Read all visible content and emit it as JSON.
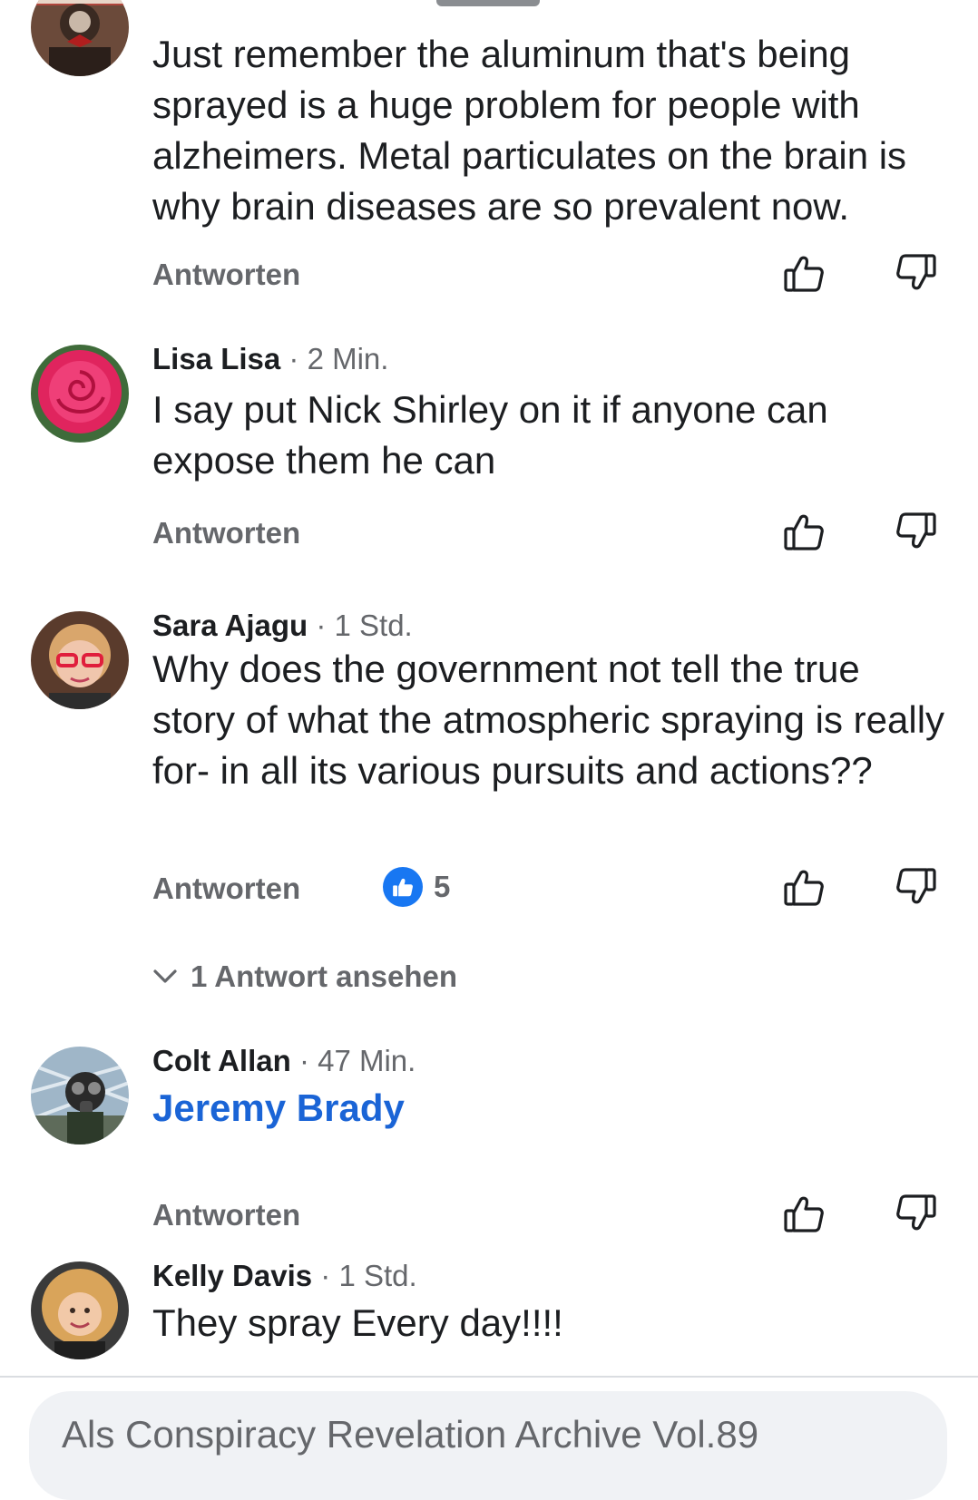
{
  "comments": [
    {
      "author": "",
      "time": "",
      "text": "Just remember the aluminum that's being sprayed is a huge problem for people with alzheimers. Metal particulates on the brain is why brain diseases are so prevalent  now.",
      "reply_label": "Antworten"
    },
    {
      "author": "Lisa Lisa",
      "separator": " · ",
      "time": "2 Min.",
      "text": "I say put Nick Shirley on it if anyone can expose them he can",
      "reply_label": "Antworten"
    },
    {
      "author": "Sara Ajagu",
      "separator": " · ",
      "time": "1 Std.",
      "text": "Why does the government not tell the true story of what the atmospheric spraying is really for- in all its various pursuits and actions??",
      "reply_label": "Antworten",
      "reaction_count": "5",
      "view_replies_label": "1 Antwort ansehen"
    },
    {
      "author": "Colt Allan",
      "separator": " · ",
      "time": "47 Min.",
      "text": "Jeremy Brady",
      "reply_label": "Antworten"
    },
    {
      "author": "Kelly Davis",
      "separator": " · ",
      "time": "1 Std.",
      "text": "They spray Every day!!!!"
    }
  ],
  "composer": {
    "placeholder": "Als Conspiracy Revelation Archive Vol.89"
  },
  "icons": {
    "like": "thumbs-up-outline-icon",
    "dislike": "thumbs-down-outline-icon",
    "reaction": "like-reaction-icon",
    "expand": "chevron-down-icon"
  },
  "colors": {
    "accent": "#1877f2",
    "mention": "#1a64d6",
    "secondary_text": "#65676b"
  }
}
